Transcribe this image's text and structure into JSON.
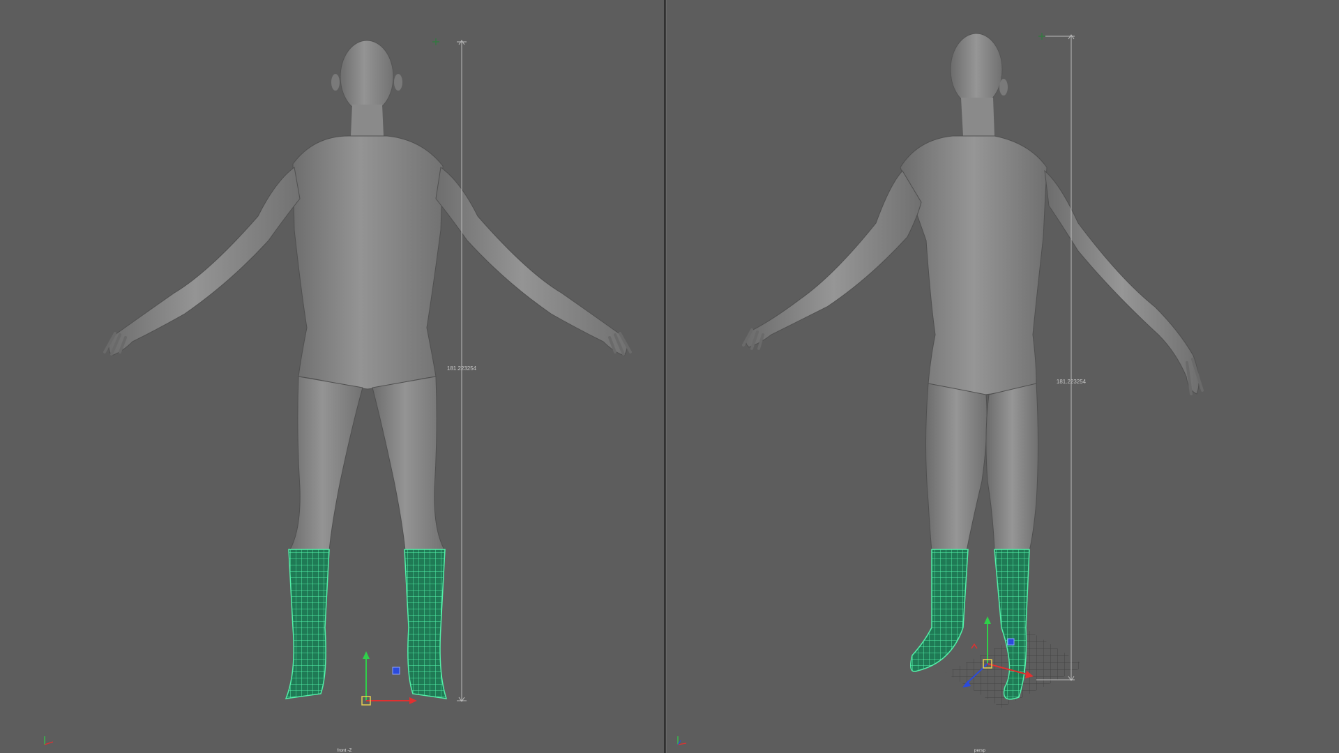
{
  "viewports": {
    "front": {
      "camera_label": "front -Z",
      "measure_value": "181.223254"
    },
    "persp": {
      "camera_label": "persp",
      "measure_value": "181.223254"
    }
  },
  "colors": {
    "background": "#5d5d5d",
    "mesh": "#8b8b8b",
    "wireframe": "#52f0a8",
    "axis_x": "#e23030",
    "axis_y": "#2fd04a",
    "axis_z": "#2b4bdc",
    "pivot": "#e5cf52"
  },
  "icons": {
    "view_axis": "view-axis-icon",
    "move_manipulator": "move-manipulator-icon",
    "distance_locator": "distance-locator-icon"
  }
}
